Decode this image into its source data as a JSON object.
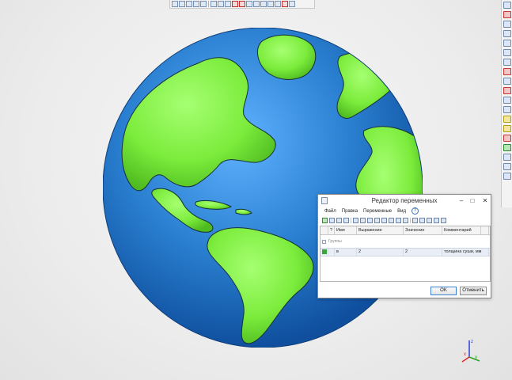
{
  "dialog": {
    "title": "Редактор переменных",
    "menu": [
      "Файл",
      "Правка",
      "Переменные",
      "Вид"
    ],
    "help_symbol": "?",
    "columns": [
      "?",
      "Имя",
      "Выражение",
      "Значение",
      "Комментарий"
    ],
    "group_label": "Группы",
    "variable": {
      "name": "в",
      "expression": "2",
      "value": "2",
      "comment": "толщина суши, мм"
    },
    "ok_label": "OK",
    "cancel_label": "Отменить",
    "window_controls": {
      "minimize": "–",
      "maximize": "□",
      "close": "✕"
    }
  },
  "axis": {
    "x": "x",
    "y": "y",
    "z": "z"
  },
  "colors": {
    "ocean": "#2a7fd0",
    "land": "#7cec3c",
    "accent": "#3c7fd1"
  }
}
